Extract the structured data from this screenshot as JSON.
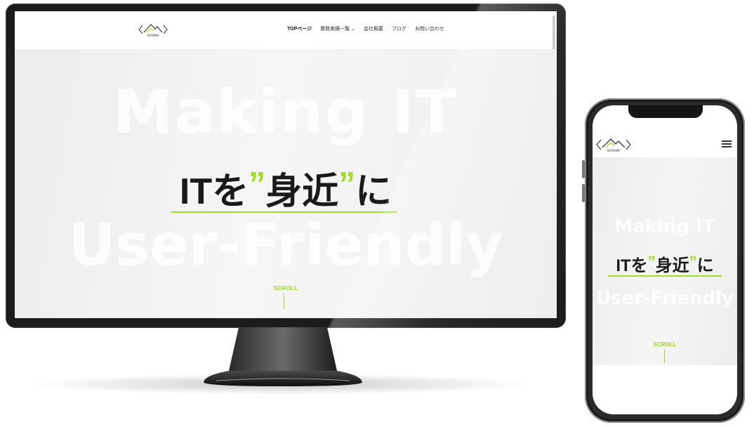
{
  "desktop": {
    "logo": {
      "brand_text": "SOYAMA",
      "icon": "mountain-logo-icon"
    },
    "nav": {
      "items": [
        {
          "label": "TOPページ",
          "active": true
        },
        {
          "label": "業務実績一覧 ⌄",
          "active": false
        },
        {
          "label": "会社概要",
          "active": false
        },
        {
          "label": "ブログ",
          "active": false
        },
        {
          "label": "お問い合わせ",
          "active": false
        }
      ]
    },
    "hero": {
      "bg_line_1": "Making IT",
      "bg_line_2": "User-Friendly",
      "catch_pre": "ITを",
      "catch_word": "身近",
      "catch_post": "に",
      "quote_mark": "”",
      "scroll_label": "SCROLL"
    }
  },
  "mobile": {
    "logo": {
      "brand_text": "SOYAMA",
      "icon": "mountain-logo-icon"
    },
    "menu_icon": "hamburger-menu-icon",
    "hero": {
      "bg_line_1": "Making IT",
      "bg_line_2": "User-Friendly",
      "catch_pre": "ITを",
      "catch_word": "身近",
      "catch_post": "に",
      "quote_mark": "”",
      "scroll_label": "SCROLL"
    }
  },
  "colors": {
    "accent": "#a6dc1f",
    "text": "#1a1a1a",
    "hero_bg": "#ececec",
    "bezel": "#1c1c1c"
  }
}
